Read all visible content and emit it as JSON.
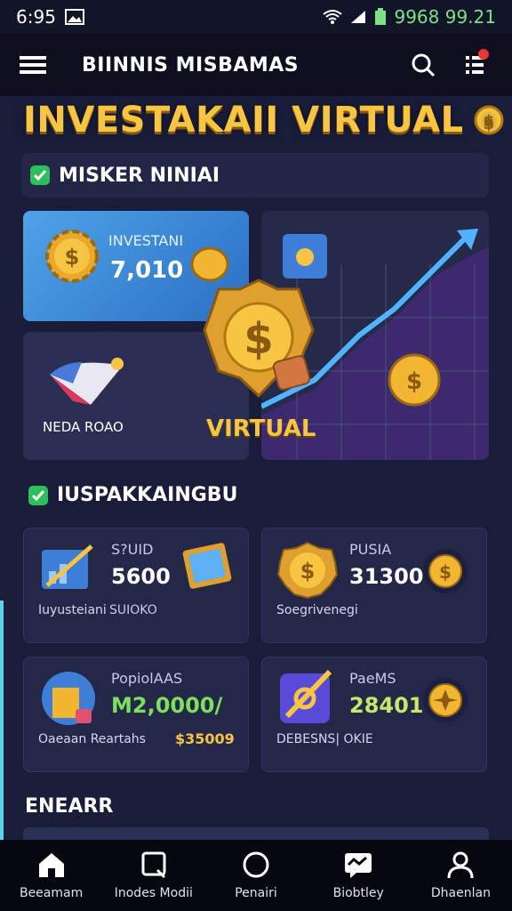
{
  "status": {
    "time": "6:95",
    "right_text": "9968 99.21"
  },
  "appbar": {
    "title": "BIINNIS MISBAMAS"
  },
  "hero": {
    "title": "INVESTAKAII VIRTUAL"
  },
  "section1": {
    "title": "MISKER NINIAI"
  },
  "featured": {
    "invest_label": "INVESTANI",
    "invest_value": "7,010",
    "small_label": "NEDA ROAO",
    "virtual_label": "VIRTUAL"
  },
  "section2": {
    "title": "IUSPAKKAINGBU"
  },
  "cards": [
    {
      "label": "S?UID",
      "value": "5600",
      "sub": "Iuyusteiani",
      "sub2": "SUIOKO"
    },
    {
      "label": "PUSIA",
      "value": "31300",
      "sub": "Soegrivenegi",
      "sub2": ""
    },
    {
      "label": "PopiolAAS",
      "value": "M2,0000/",
      "sub": "Oaeaan Reartahs",
      "sub2": "$35009"
    },
    {
      "label": "PaeMS",
      "value": "28401",
      "sub": "DEBESNS| OKIE",
      "sub2": ""
    }
  ],
  "earn": {
    "title": "ENEARR"
  },
  "nav": [
    {
      "label": "Beeamam",
      "icon": "home-icon"
    },
    {
      "label": "Inodes Modii",
      "icon": "search-icon"
    },
    {
      "label": "Penairi",
      "icon": "circle-icon"
    },
    {
      "label": "Biobtley",
      "icon": "chat-icon"
    },
    {
      "label": "Dhaenlan",
      "icon": "user-icon"
    }
  ],
  "colors": {
    "accent_gold": "#f7c542",
    "bg": "#1a1d3a",
    "green": "#2fbf5a",
    "blue": "#4fa3e8"
  }
}
